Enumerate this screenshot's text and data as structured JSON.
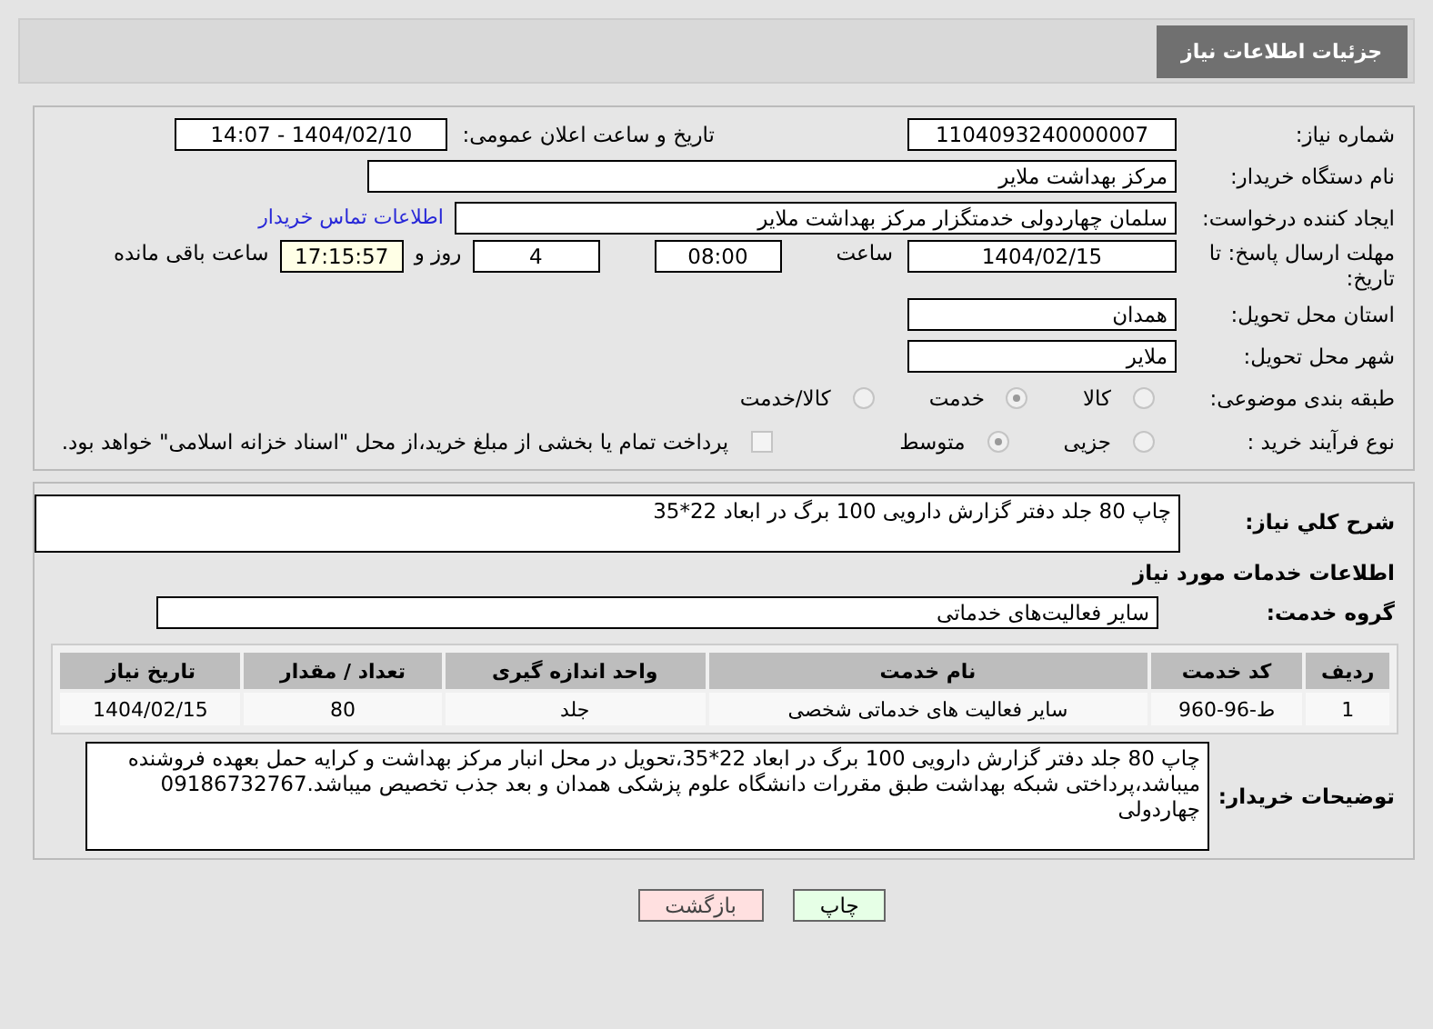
{
  "page_title": "جزئیات اطلاعات نیاز",
  "details": {
    "need_number": {
      "label": "شماره نیاز:",
      "value": "1104093240000007"
    },
    "announce": {
      "label": "تاریخ و ساعت اعلان عمومی:",
      "value": "1404/02/10 - 14:07"
    },
    "buyer_org": {
      "label": "نام دستگاه خریدار:",
      "value": "مرکز بهداشت ملایر"
    },
    "requester": {
      "label": "ایجاد کننده درخواست:",
      "value": "سلمان چهاردولی خدمتگزار مرکز بهداشت ملایر",
      "link": "اطلاعات تماس خریدار"
    },
    "deadline": {
      "label": "مهلت ارسال پاسخ: تا تاریخ:",
      "date": "1404/02/15",
      "time_label": "ساعت",
      "time": "08:00",
      "days": "4",
      "days_label": "روز و",
      "remaining": "17:15:57",
      "remaining_label": "ساعت باقی مانده"
    },
    "province": {
      "label": "استان محل تحویل:",
      "value": "همدان"
    },
    "city": {
      "label": "شهر محل تحویل:",
      "value": "ملایر"
    },
    "category": {
      "label": "طبقه بندی موضوعی:",
      "options": [
        {
          "label": "کالا",
          "selected": false
        },
        {
          "label": "خدمت",
          "selected": true
        },
        {
          "label": "کالا/خدمت",
          "selected": false
        }
      ]
    },
    "process": {
      "label": "نوع فرآیند خرید :",
      "options": [
        {
          "label": "جزیی",
          "selected": false
        },
        {
          "label": "متوسط",
          "selected": true
        }
      ],
      "payment": {
        "checked": false,
        "text": "پرداخت تمام یا بخشی از مبلغ خرید،از محل \"اسناد خزانه اسلامی\" خواهد بود."
      }
    }
  },
  "services": {
    "summary_label": "شرح کلي نياز:",
    "summary": "چاپ 80 جلد دفتر گزارش دارویی 100 برگ در ابعاد 22*35",
    "heading": "اطلاعات خدمات مورد نیاز",
    "group_label": "گروه خدمت:",
    "group": "سایر فعالیت‌های خدماتی",
    "table": {
      "columns": [
        "ردیف",
        "کد خدمت",
        "نام خدمت",
        "واحد اندازه گیری",
        "تعداد / مقدار",
        "تاریخ نیاز"
      ],
      "rows": [
        [
          "1",
          "ط-96-960",
          "سایر فعالیت های خدماتی شخصی",
          "جلد",
          "80",
          "1404/02/15"
        ]
      ]
    },
    "notes_label": "توضیحات خریدار:",
    "notes": "چاپ 80 جلد دفتر گزارش دارویی 100 برگ در ابعاد 22*35،تحویل در محل انبار مرکز بهداشت و کرایه حمل بعهده فروشنده میباشد،پرداختی شبکه بهداشت طبق مقررات دانشگاه علوم پزشکی همدان و بعد جذب تخصیص میباشد.09186732767 چهاردولی"
  },
  "buttons": [
    {
      "label": "چاپ",
      "kind": "print"
    },
    {
      "label": "بازگشت",
      "kind": "back"
    }
  ]
}
